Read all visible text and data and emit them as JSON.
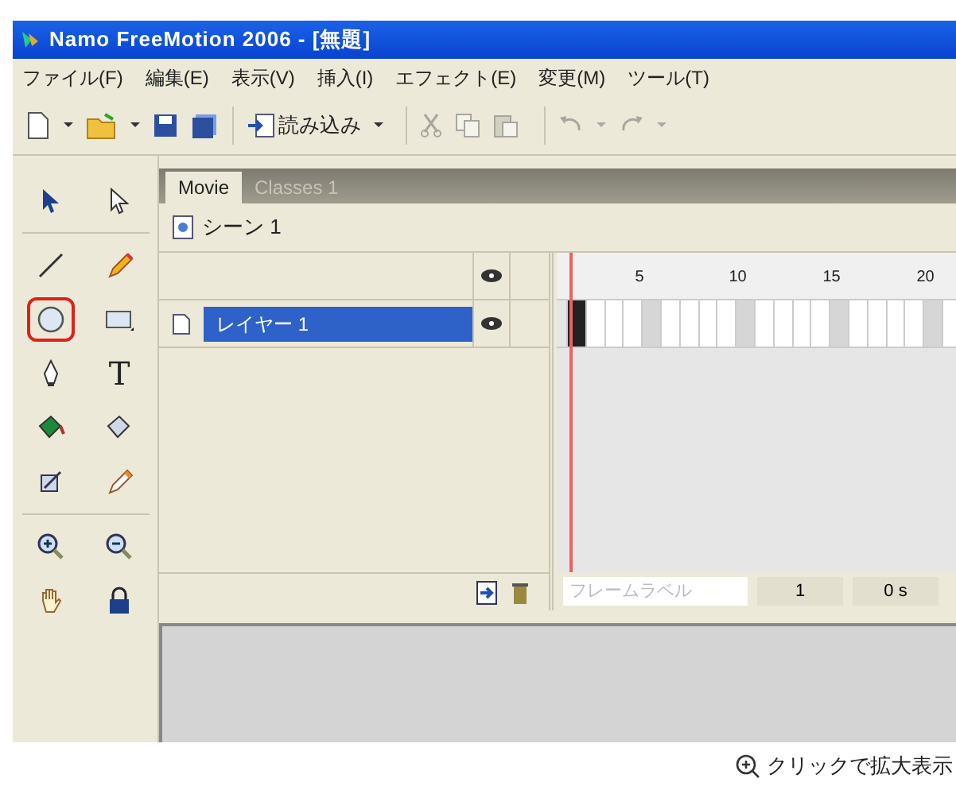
{
  "window": {
    "title": "Namo FreeMotion 2006 - [無題]"
  },
  "menu": [
    "ファイル(F)",
    "編集(E)",
    "表示(V)",
    "挿入(I)",
    "エフェクト(E)",
    "変更(M)",
    "ツール(T)"
  ],
  "toolbar": {
    "import_label": "読み込み"
  },
  "tools": [
    {
      "kind": "arrow",
      "selected": false
    },
    {
      "kind": "subselect",
      "selected": false
    },
    {
      "kind": "line",
      "selected": false
    },
    {
      "kind": "pencil",
      "selected": false
    },
    {
      "kind": "ellipse",
      "selected": true
    },
    {
      "kind": "rectangle",
      "selected": false
    },
    {
      "kind": "pen",
      "selected": false
    },
    {
      "kind": "text",
      "label": "T",
      "selected": false
    },
    {
      "kind": "bucket",
      "selected": false
    },
    {
      "kind": "inkpot",
      "selected": false
    },
    {
      "kind": "transform",
      "selected": false
    },
    {
      "kind": "eyedropper",
      "selected": false
    },
    {
      "kind": "zoomin",
      "selected": false
    },
    {
      "kind": "zoomout",
      "selected": false
    },
    {
      "kind": "hand",
      "selected": false
    },
    {
      "kind": "lock",
      "selected": false
    }
  ],
  "tabs": [
    {
      "label": "Movie",
      "selected": true
    },
    {
      "label": "Classes 1",
      "selected": false
    }
  ],
  "scene": {
    "label": "シーン 1"
  },
  "layers": [
    {
      "name": "レイヤー 1",
      "selected": true
    }
  ],
  "ruler": [
    "5",
    "10",
    "15",
    "20"
  ],
  "timeline_footer": {
    "frame_label_placeholder": "フレームラベル",
    "frame": "1",
    "time": "0 s"
  },
  "caption": "クリックで拡大表示"
}
